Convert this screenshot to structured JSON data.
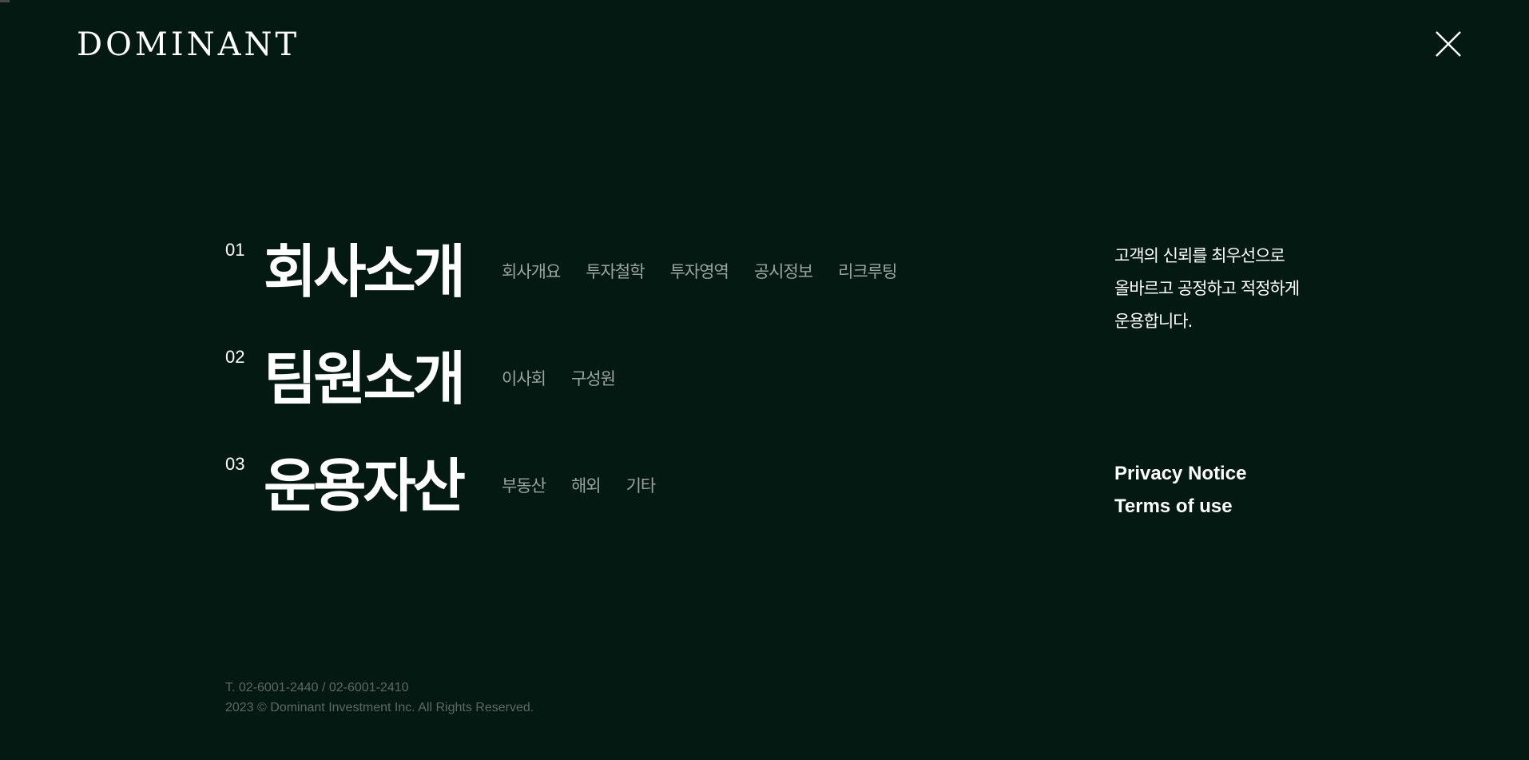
{
  "header": {
    "logo_text": "DOMINANT",
    "close_icon": "close-icon"
  },
  "menu": [
    {
      "number": "01",
      "title": "회사소개",
      "items": [
        "회사개요",
        "투자철학",
        "투자영역",
        "공시정보",
        "리크루팅"
      ]
    },
    {
      "number": "02",
      "title": "팀원소개",
      "items": [
        "이사회",
        "구성원"
      ]
    },
    {
      "number": "03",
      "title": "운용자산",
      "items": [
        "부동산",
        "해외",
        "기타"
      ]
    }
  ],
  "slogan": {
    "line1": "고객의 신뢰를 최우선으로",
    "line2": "올바르고 공정하고 적정하게",
    "line3": "운용합니다."
  },
  "links": {
    "privacy": "Privacy Notice",
    "terms": "Terms of use"
  },
  "footer": {
    "phone": "T. 02-6001-2440 / 02-6001-2410",
    "copyright": "2023 © Dominant Investment Inc. All Rights Reserved."
  },
  "colors": {
    "background": "#031912",
    "primary_text": "#ffffff",
    "submenu_text": "#9aa39e",
    "footer_text": "#5e6863"
  }
}
